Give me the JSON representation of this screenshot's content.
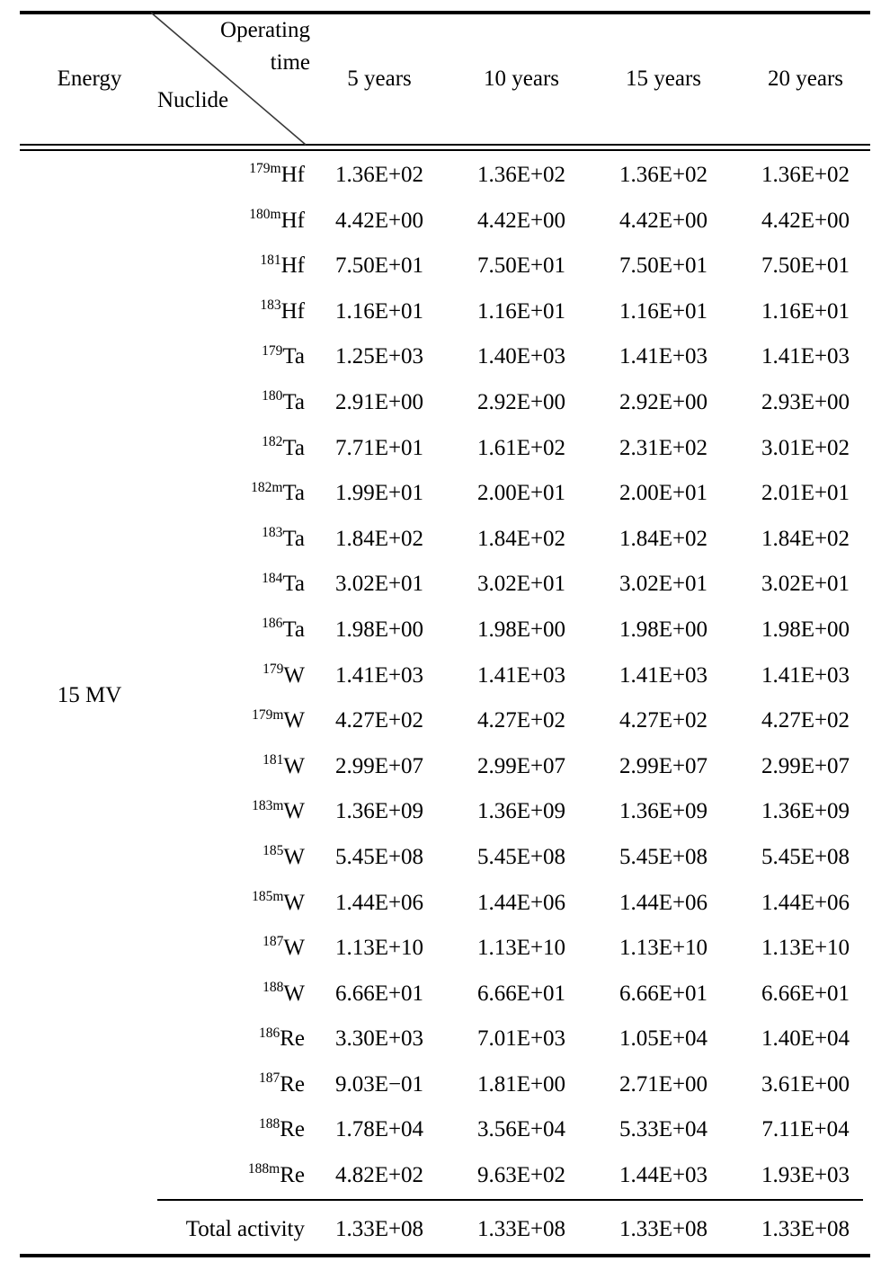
{
  "table": {
    "header": {
      "energy_label": "Energy",
      "operating_time_label_line1": "Operating",
      "operating_time_label_line2": "time",
      "nuclide_label": "Nuclide",
      "columns": [
        "5  years",
        "10  years",
        "15  years",
        "20  years"
      ]
    },
    "energy_group": "15 MV",
    "rows": [
      {
        "mass": "179m",
        "element": "Hf",
        "values": [
          "1.36E+02",
          "1.36E+02",
          "1.36E+02",
          "1.36E+02"
        ]
      },
      {
        "mass": "180m",
        "element": "Hf",
        "values": [
          "4.42E+00",
          "4.42E+00",
          "4.42E+00",
          "4.42E+00"
        ]
      },
      {
        "mass": "181",
        "element": "Hf",
        "values": [
          "7.50E+01",
          "7.50E+01",
          "7.50E+01",
          "7.50E+01"
        ]
      },
      {
        "mass": "183",
        "element": "Hf",
        "values": [
          "1.16E+01",
          "1.16E+01",
          "1.16E+01",
          "1.16E+01"
        ]
      },
      {
        "mass": "179",
        "element": "Ta",
        "values": [
          "1.25E+03",
          "1.40E+03",
          "1.41E+03",
          "1.41E+03"
        ]
      },
      {
        "mass": "180",
        "element": "Ta",
        "values": [
          "2.91E+00",
          "2.92E+00",
          "2.92E+00",
          "2.93E+00"
        ]
      },
      {
        "mass": "182",
        "element": "Ta",
        "values": [
          "7.71E+01",
          "1.61E+02",
          "2.31E+02",
          "3.01E+02"
        ]
      },
      {
        "mass": "182m",
        "element": "Ta",
        "values": [
          "1.99E+01",
          "2.00E+01",
          "2.00E+01",
          "2.01E+01"
        ]
      },
      {
        "mass": "183",
        "element": "Ta",
        "values": [
          "1.84E+02",
          "1.84E+02",
          "1.84E+02",
          "1.84E+02"
        ]
      },
      {
        "mass": "184",
        "element": "Ta",
        "values": [
          "3.02E+01",
          "3.02E+01",
          "3.02E+01",
          "3.02E+01"
        ]
      },
      {
        "mass": "186",
        "element": "Ta",
        "values": [
          "1.98E+00",
          "1.98E+00",
          "1.98E+00",
          "1.98E+00"
        ]
      },
      {
        "mass": "179",
        "element": "W",
        "values": [
          "1.41E+03",
          "1.41E+03",
          "1.41E+03",
          "1.41E+03"
        ]
      },
      {
        "mass": "179m",
        "element": "W",
        "values": [
          "4.27E+02",
          "4.27E+02",
          "4.27E+02",
          "4.27E+02"
        ]
      },
      {
        "mass": "181",
        "element": "W",
        "values": [
          "2.99E+07",
          "2.99E+07",
          "2.99E+07",
          "2.99E+07"
        ]
      },
      {
        "mass": "183m",
        "element": "W",
        "values": [
          "1.36E+09",
          "1.36E+09",
          "1.36E+09",
          "1.36E+09"
        ]
      },
      {
        "mass": "185",
        "element": "W",
        "values": [
          "5.45E+08",
          "5.45E+08",
          "5.45E+08",
          "5.45E+08"
        ]
      },
      {
        "mass": "185m",
        "element": "W",
        "values": [
          "1.44E+06",
          "1.44E+06",
          "1.44E+06",
          "1.44E+06"
        ]
      },
      {
        "mass": "187",
        "element": "W",
        "values": [
          "1.13E+10",
          "1.13E+10",
          "1.13E+10",
          "1.13E+10"
        ]
      },
      {
        "mass": "188",
        "element": "W",
        "values": [
          "6.66E+01",
          "6.66E+01",
          "6.66E+01",
          "6.66E+01"
        ]
      },
      {
        "mass": "186",
        "element": "Re",
        "values": [
          "3.30E+03",
          "7.01E+03",
          "1.05E+04",
          "1.40E+04"
        ]
      },
      {
        "mass": "187",
        "element": "Re",
        "values": [
          "9.03E−01",
          "1.81E+00",
          "2.71E+00",
          "3.61E+00"
        ]
      },
      {
        "mass": "188",
        "element": "Re",
        "values": [
          "1.78E+04",
          "3.56E+04",
          "5.33E+04",
          "7.11E+04"
        ]
      },
      {
        "mass": "188m",
        "element": "Re",
        "values": [
          "4.82E+02",
          "9.63E+02",
          "1.44E+03",
          "1.93E+03"
        ]
      }
    ],
    "total": {
      "label": "Total activity",
      "values": [
        "1.33E+08",
        "1.33E+08",
        "1.33E+08",
        "1.33E+08"
      ]
    }
  }
}
